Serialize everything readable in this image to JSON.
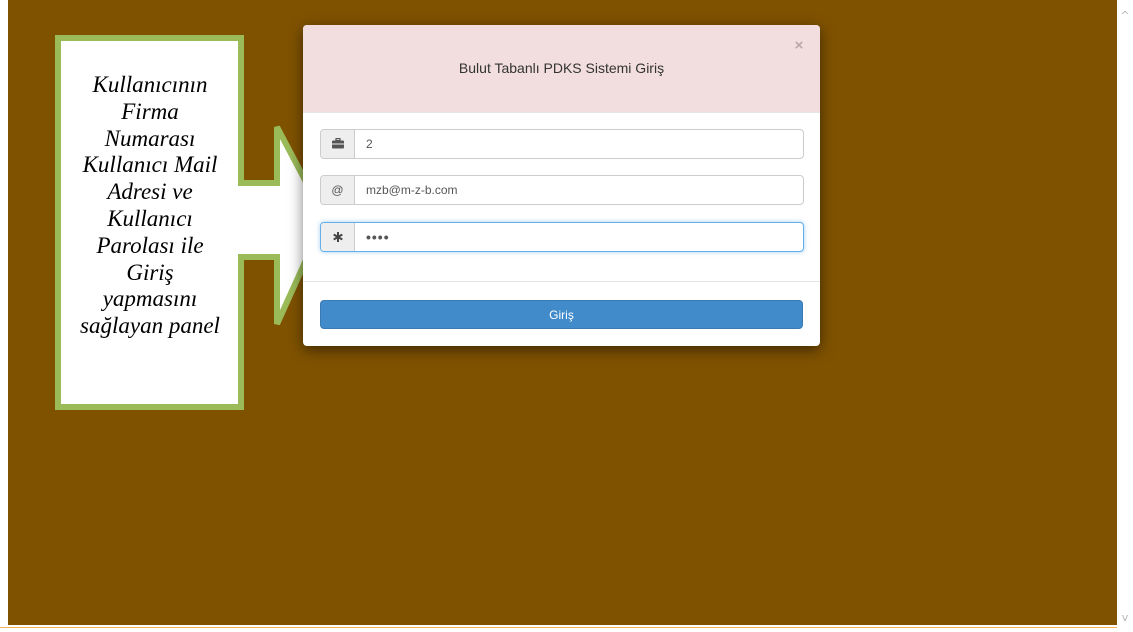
{
  "annotation": {
    "lines": [
      "Kullanıcının",
      "Firma",
      "Numarası",
      "Kullanıcı Mail",
      "Adresi ve",
      "Kullanıcı",
      "Parolası ile",
      "Giriş",
      "yapmasını",
      "sağlayan panel"
    ]
  },
  "modal": {
    "title": "Bulut Tabanlı PDKS Sistemi Giriş",
    "close_label": "×",
    "company_field": {
      "icon": "briefcase-icon",
      "value": "2"
    },
    "email_field": {
      "icon_text": "@",
      "value": "mzb@m-z-b.com"
    },
    "password_field": {
      "icon": "asterisk-icon",
      "value": "••••"
    },
    "login_button": "Giriş"
  },
  "scrollbar": {
    "up_arrow": "^",
    "down_arrow": "v"
  },
  "colors": {
    "backdrop": "#7f5200",
    "modal_header": "#f2dede",
    "primary_button": "#428bca",
    "callout_border": "#9bbb59"
  }
}
